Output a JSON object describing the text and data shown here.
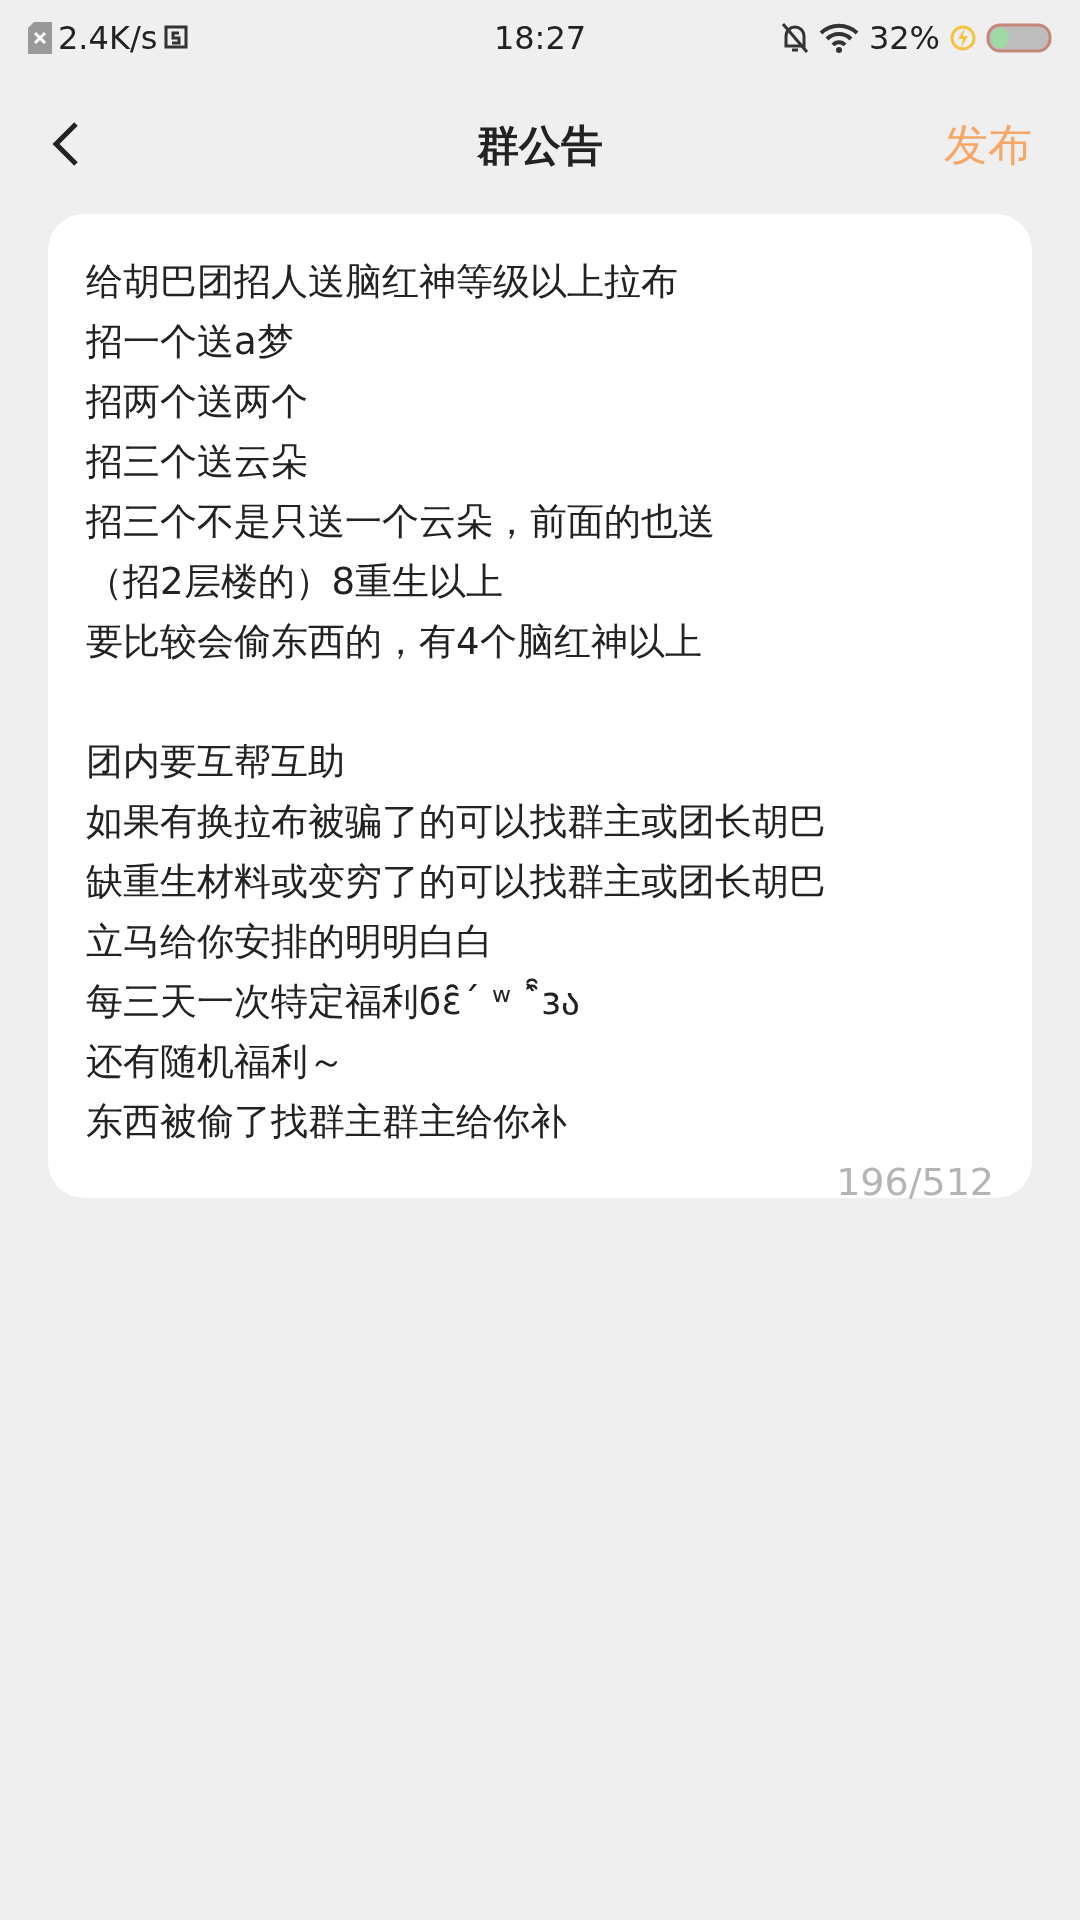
{
  "status_bar": {
    "speed": "2.4K/s",
    "time": "18:27",
    "battery": "32%"
  },
  "header": {
    "title": "群公告",
    "action": "发布"
  },
  "announcement": {
    "paragraphs": [
      [
        "给胡巴团招人送脑红神等级以上拉布",
        "招一个送a梦",
        "招两个送两个",
        "招三个送云朵",
        "招三个不是只送一个云朵，前面的也送",
        "（招2层楼的）8重生以上",
        "要比较会偷东西的，有4个脑红神以上"
      ],
      [
        "团内要互帮互助",
        "如果有换拉布被骗了的可以找群主或团长胡巴",
        "缺重生材料或变穷了的可以找群主或团长胡巴",
        "立马给你安排的明明白白",
        "每三天一次特定福利ϭɛ̑̑ˊ ʷ ˋ̑̑ɜა",
        "还有随机福利～",
        "东西被偷了找群主群主给你补"
      ]
    ],
    "counter": "196/512"
  }
}
